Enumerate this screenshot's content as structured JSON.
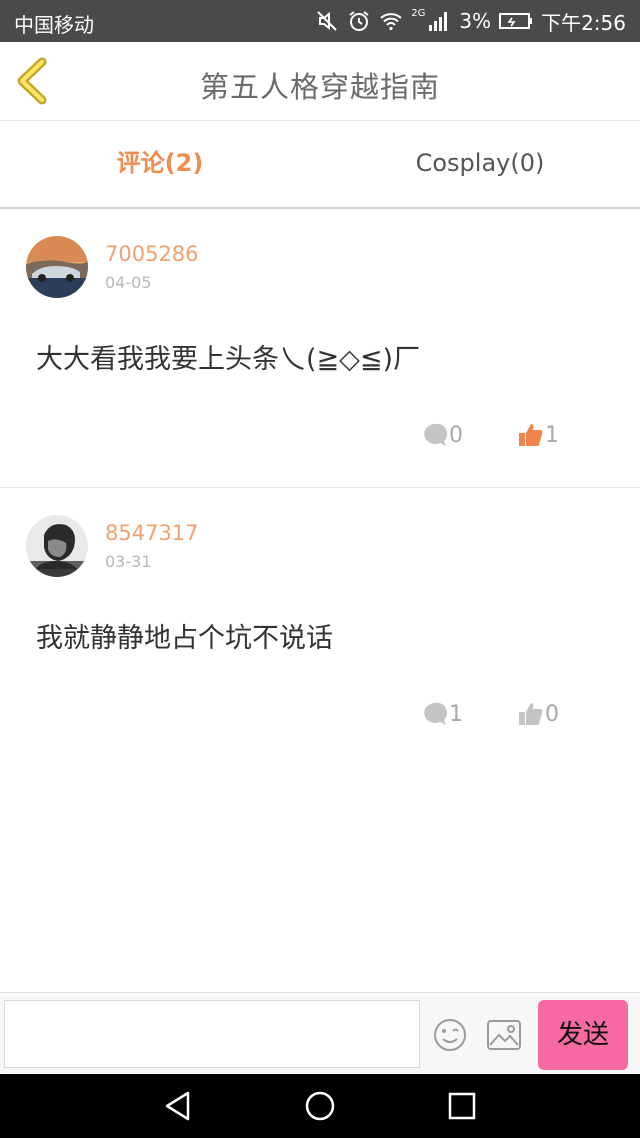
{
  "status_bar": {
    "carrier": "中国移动",
    "network": "2G",
    "battery": "3%",
    "time": "下午2:56"
  },
  "header": {
    "title": "第五人格穿越指南",
    "back_icon": "chevron-left-icon"
  },
  "tabs": [
    {
      "label": "评论(2)",
      "active": true
    },
    {
      "label": "Cosplay(0)",
      "active": false
    }
  ],
  "comments": [
    {
      "username": "7005286",
      "date": "04-05",
      "text": "大大看我我要上头条乀(≧◇≦)厂",
      "reply_count": "0",
      "like_count": "1",
      "liked": true
    },
    {
      "username": "8547317",
      "date": "03-31",
      "text": "我就静静地占个坑不说话",
      "reply_count": "1",
      "like_count": "0",
      "liked": false
    }
  ],
  "input_bar": {
    "placeholder": "",
    "send_label": "发送"
  },
  "colors": {
    "accent": "#f08c50",
    "send_button": "#f76aa1",
    "status_bar": "#4a4a4a"
  }
}
